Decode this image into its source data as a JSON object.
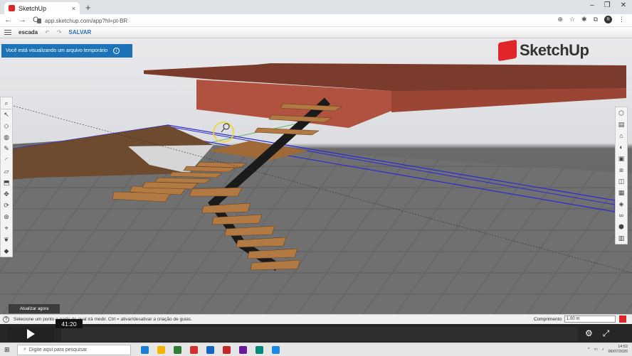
{
  "browser": {
    "tab_title": "SketchUp",
    "tab_close": "×",
    "new_tab": "+",
    "window_controls": [
      "–",
      "❐",
      "✕"
    ],
    "nav": [
      "←",
      "→",
      "C"
    ],
    "url": "app.sketchup.com/app?hl=pt-BR",
    "profile_initial": "R"
  },
  "app": {
    "document_name": "escada",
    "save_label": "SALVAR",
    "banner_text": "Você está visualizando um arquivo temporário",
    "logo_text": "SketchUp",
    "update_button": "Atualizar agora"
  },
  "left_tools": [
    "search-icon",
    "select-icon",
    "eraser-icon",
    "paint-icon",
    "pencil-icon",
    "arc-icon",
    "shape-icon",
    "push-pull-icon",
    "move-icon",
    "rotate-icon",
    "orbit-icon",
    "tape-icon",
    "walk-icon",
    "section-icon"
  ],
  "right_tools": [
    "entity-info-icon",
    "instructor-icon",
    "components-icon",
    "materials-icon",
    "styles-icon",
    "layers-icon",
    "scenes-icon",
    "shadows-icon",
    "display-icon",
    "outliner-icon",
    "solid-icon",
    "trash-icon"
  ],
  "status": {
    "help": "?",
    "text": "Selecione um ponto a partir do qual irá medir. Ctrl = ativar/desativar a criação de guias.",
    "measure_label": "Comprimento",
    "measure_value": "1.00 m"
  },
  "video": {
    "timecode": "41:20",
    "settings_icon": "⚙",
    "fullscreen_icon": "⤢"
  },
  "taskbar": {
    "search_placeholder": "Digite aqui para pesquisar",
    "app_colors": [
      "#1a7fd6",
      "#f4b400",
      "#2e7d32",
      "#d32f2f",
      "#1565c0",
      "#c62828",
      "#6a1b9a",
      "#00897b",
      "#1e88e5"
    ],
    "clock_time": "14:52",
    "clock_date": "06/07/2020"
  },
  "colors": {
    "accent": "#1d73b8",
    "brand": "#e0262b",
    "wood": "#a8703a",
    "slab": "#8b3a2c"
  }
}
